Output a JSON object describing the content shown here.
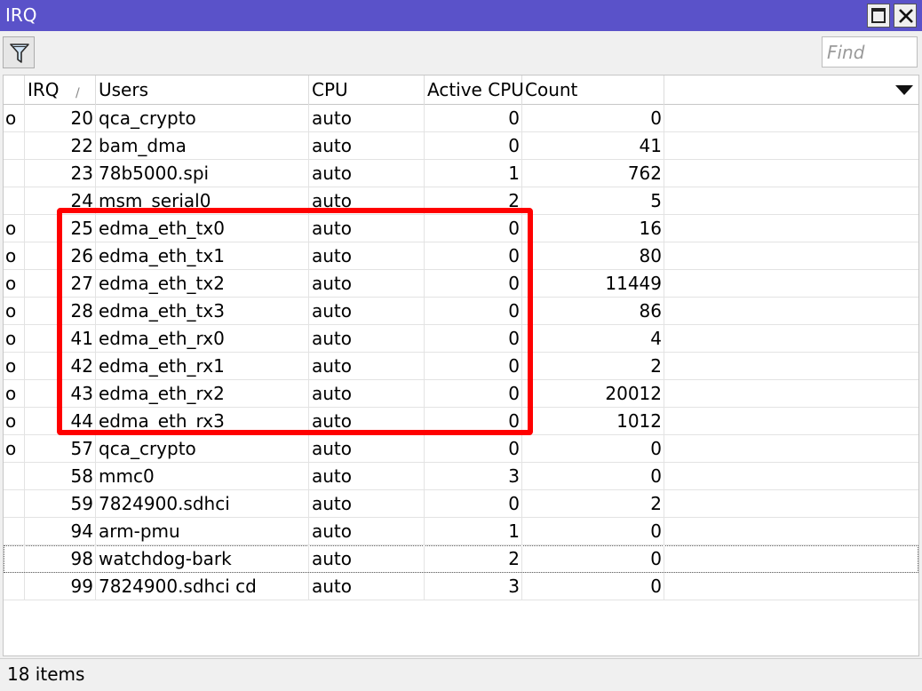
{
  "window": {
    "title": "IRQ",
    "maximize_icon": "maximize-icon",
    "close_icon": "close-icon"
  },
  "toolbar": {
    "filter_icon": "filter-icon",
    "find_placeholder": "Find"
  },
  "table": {
    "columns": {
      "irq": "IRQ",
      "users": "Users",
      "cpu": "CPU",
      "active_cpu": "Active CPU",
      "count": "Count"
    },
    "sort_indicator": "/",
    "rows": [
      {
        "flag": "o",
        "irq": "20",
        "users": "qca_crypto",
        "cpu": "auto",
        "active_cpu": "0",
        "count": "0"
      },
      {
        "flag": "",
        "irq": "22",
        "users": "bam_dma",
        "cpu": "auto",
        "active_cpu": "0",
        "count": "41"
      },
      {
        "flag": "",
        "irq": "23",
        "users": "78b5000.spi",
        "cpu": "auto",
        "active_cpu": "1",
        "count": "762"
      },
      {
        "flag": "",
        "irq": "24",
        "users": "msm_serial0",
        "cpu": "auto",
        "active_cpu": "2",
        "count": "5"
      },
      {
        "flag": "o",
        "irq": "25",
        "users": "edma_eth_tx0",
        "cpu": "auto",
        "active_cpu": "0",
        "count": "16"
      },
      {
        "flag": "o",
        "irq": "26",
        "users": "edma_eth_tx1",
        "cpu": "auto",
        "active_cpu": "0",
        "count": "80"
      },
      {
        "flag": "o",
        "irq": "27",
        "users": "edma_eth_tx2",
        "cpu": "auto",
        "active_cpu": "0",
        "count": "11449"
      },
      {
        "flag": "o",
        "irq": "28",
        "users": "edma_eth_tx3",
        "cpu": "auto",
        "active_cpu": "0",
        "count": "86"
      },
      {
        "flag": "o",
        "irq": "41",
        "users": "edma_eth_rx0",
        "cpu": "auto",
        "active_cpu": "0",
        "count": "4"
      },
      {
        "flag": "o",
        "irq": "42",
        "users": "edma_eth_rx1",
        "cpu": "auto",
        "active_cpu": "0",
        "count": "2"
      },
      {
        "flag": "o",
        "irq": "43",
        "users": "edma_eth_rx2",
        "cpu": "auto",
        "active_cpu": "0",
        "count": "20012"
      },
      {
        "flag": "o",
        "irq": "44",
        "users": "edma_eth_rx3",
        "cpu": "auto",
        "active_cpu": "0",
        "count": "1012"
      },
      {
        "flag": "o",
        "irq": "57",
        "users": "qca_crypto",
        "cpu": "auto",
        "active_cpu": "0",
        "count": "0"
      },
      {
        "flag": "",
        "irq": "58",
        "users": "mmc0",
        "cpu": "auto",
        "active_cpu": "3",
        "count": "0"
      },
      {
        "flag": "",
        "irq": "59",
        "users": "7824900.sdhci",
        "cpu": "auto",
        "active_cpu": "0",
        "count": "2"
      },
      {
        "flag": "",
        "irq": "94",
        "users": "arm-pmu",
        "cpu": "auto",
        "active_cpu": "1",
        "count": "0"
      },
      {
        "flag": "",
        "irq": "98",
        "users": "watchdog-bark",
        "cpu": "auto",
        "active_cpu": "2",
        "count": "0",
        "selected": true
      },
      {
        "flag": "",
        "irq": "99",
        "users": "7824900.sdhci cd",
        "cpu": "auto",
        "active_cpu": "3",
        "count": "0"
      }
    ]
  },
  "status": {
    "items_count": "18 items"
  },
  "colors": {
    "titlebar": "#5a52c9",
    "highlight": "#ff0000"
  }
}
